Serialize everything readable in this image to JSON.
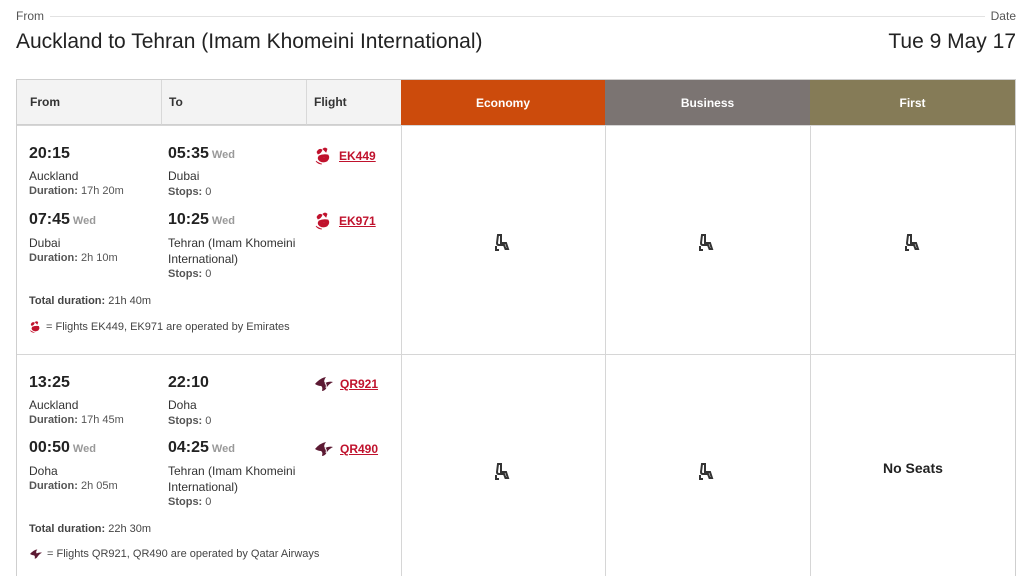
{
  "header": {
    "from_label": "From",
    "date_label": "Date",
    "route_title": "Auckland to Tehran (Imam Khomeini International)",
    "date_value": "Tue 9 May 17"
  },
  "table": {
    "columns": {
      "from": "From",
      "to": "To",
      "flight": "Flight",
      "economy": "Economy",
      "business": "Business",
      "first": "First"
    },
    "colors": {
      "economy": "#cc4b0c",
      "business": "#7b7472",
      "first": "#857b57",
      "flight_link": "#c0122d"
    }
  },
  "itineraries": [
    {
      "legs": [
        {
          "dep_time": "20:15",
          "dep_day": "",
          "dep_place": "Auckland",
          "duration_label": "Duration:",
          "duration": "17h 20m",
          "arr_time": "05:35",
          "arr_day": "Wed",
          "arr_place": "Dubai",
          "stops_label": "Stops:",
          "stops": "0",
          "airline_icon": "emirates-logo-icon",
          "flight": "EK449"
        },
        {
          "dep_time": "07:45",
          "dep_day": "Wed",
          "dep_place": "Dubai",
          "duration_label": "Duration:",
          "duration": "2h 10m",
          "arr_time": "10:25",
          "arr_day": "Wed",
          "arr_place": "Tehran (Imam Khomeini International)",
          "stops_label": "Stops:",
          "stops": "0",
          "airline_icon": "emirates-logo-icon",
          "flight": "EK971"
        }
      ],
      "total_label": "Total duration:",
      "total_duration": "21h 40m",
      "operated_note": "= Flights EK449, EK971 are operated by Emirates",
      "cabins": {
        "economy": "seat-icon",
        "business": "seat-icon",
        "first": "seat-icon"
      }
    },
    {
      "legs": [
        {
          "dep_time": "13:25",
          "dep_day": "",
          "dep_place": "Auckland",
          "duration_label": "Duration:",
          "duration": "17h 45m",
          "arr_time": "22:10",
          "arr_day": "",
          "arr_place": "Doha",
          "stops_label": "Stops:",
          "stops": "0",
          "airline_icon": "qatar-airways-logo-icon",
          "flight": "QR921"
        },
        {
          "dep_time": "00:50",
          "dep_day": "Wed",
          "dep_place": "Doha",
          "duration_label": "Duration:",
          "duration": "2h 05m",
          "arr_time": "04:25",
          "arr_day": "Wed",
          "arr_place": "Tehran (Imam Khomeini International)",
          "stops_label": "Stops:",
          "stops": "0",
          "airline_icon": "qatar-airways-logo-icon",
          "flight": "QR490"
        }
      ],
      "total_label": "Total duration:",
      "total_duration": "22h 30m",
      "operated_note": "= Flights QR921, QR490 are operated by Qatar Airways",
      "cabins": {
        "economy": "seat-icon",
        "business": "seat-icon",
        "first": "No Seats"
      }
    }
  ]
}
